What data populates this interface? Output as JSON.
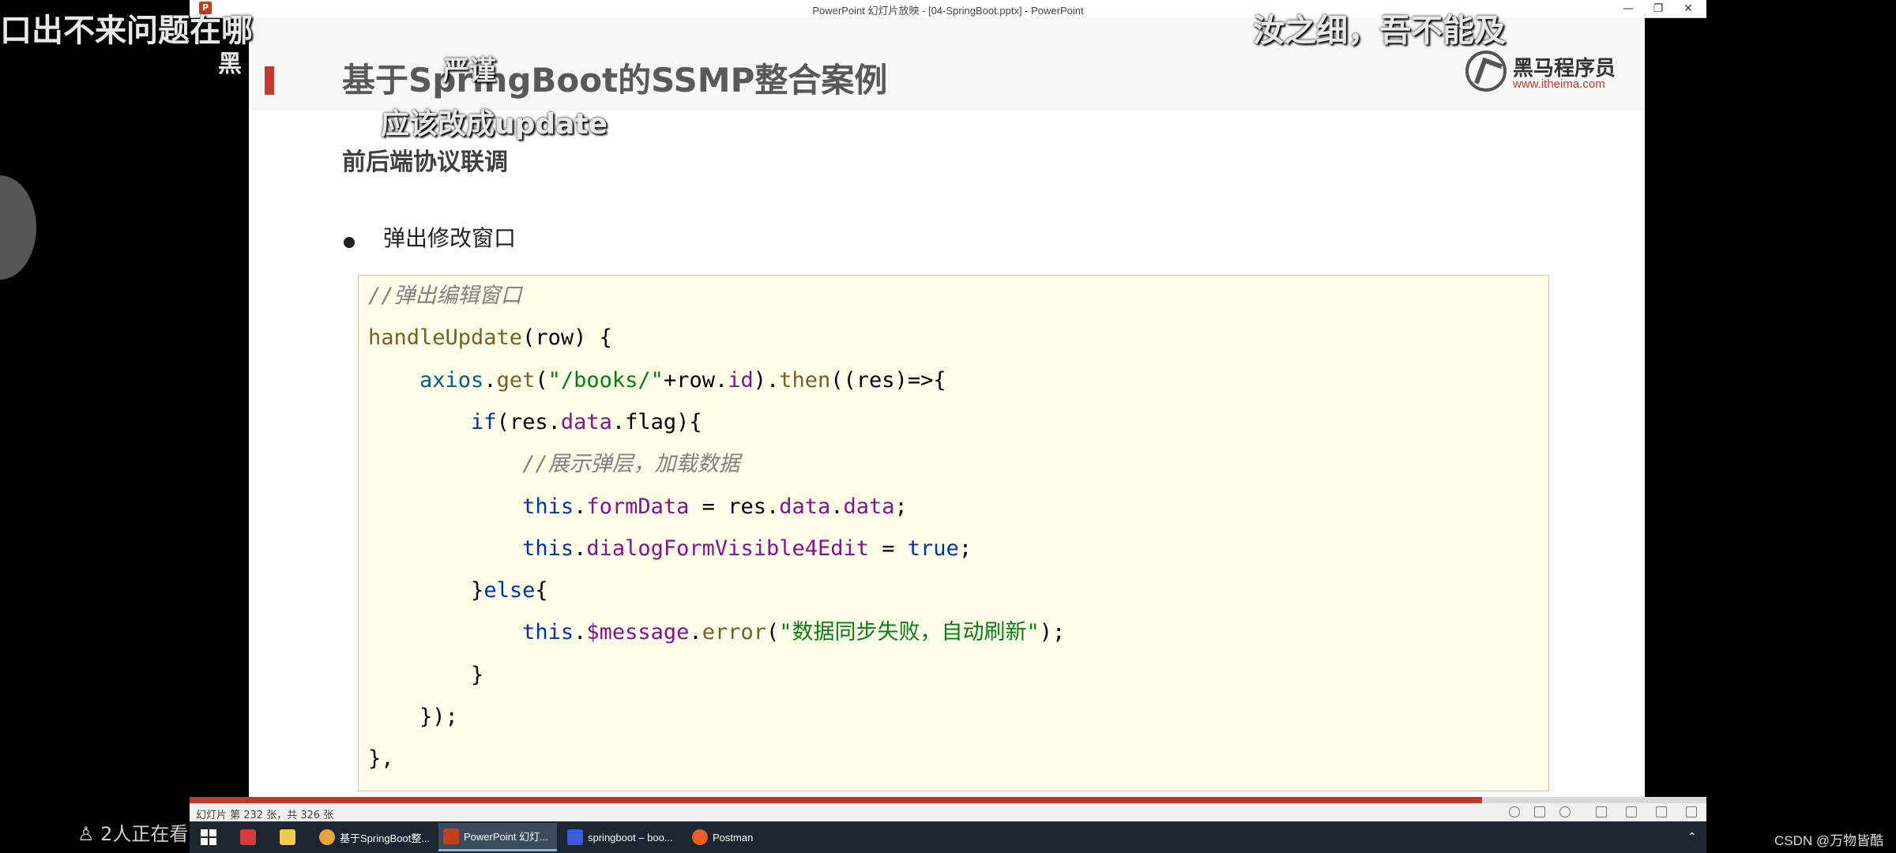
{
  "window": {
    "title": "PowerPoint 幻灯片放映 - [04-SpringBoot.pptx] - PowerPoint",
    "app_icon_letter": "P",
    "minimize": "—",
    "restore": "❐",
    "close": "✕"
  },
  "slide": {
    "title": "基于SpringBoot的SSMP整合案例",
    "subtitle": "前后端协议联调",
    "bullet": "弹出修改窗口",
    "logo": {
      "name": "黑马程序员",
      "url": "www.itheima.com"
    },
    "code_lines": [
      "//弹出编辑窗口",
      "handleUpdate(row) {",
      "    axios.get(\"/books/\"+row.id).then((res)=>{",
      "        if(res.data.flag){",
      "            //展示弹层，加载数据",
      "            this.formData = res.data.data;",
      "            this.dialogFormVisible4Edit = true;",
      "        }else{",
      "            this.$message.error(\"数据同步失败，自动刷新\");",
      "        }",
      "    });",
      "},"
    ]
  },
  "statusbar": {
    "slide_counter": "幻灯片 第 232 张，共 326 张",
    "progress": 0.852
  },
  "taskbar": {
    "items": [
      {
        "label": "基于SpringBoot整...",
        "icon": "chrome-icon",
        "color": "#e8a33d"
      },
      {
        "label": "PowerPoint 幻灯...",
        "icon": "powerpoint-icon",
        "color": "#c43e1c"
      },
      {
        "label": "springboot – boo...",
        "icon": "intellij-icon",
        "color": "#3b5bdb"
      },
      {
        "label": "Postman",
        "icon": "postman-icon",
        "color": "#ef5b25"
      }
    ]
  },
  "overlay": {
    "danmaku": [
      {
        "text": "口出不来问题在哪"
      },
      {
        "text": "黑"
      },
      {
        "text": "严谨"
      },
      {
        "text": "应该改成update"
      },
      {
        "text": "汝之细，吾不能及"
      }
    ],
    "viewer_count": "2人正在看",
    "watermark": "CSDN @万物皆酷"
  }
}
